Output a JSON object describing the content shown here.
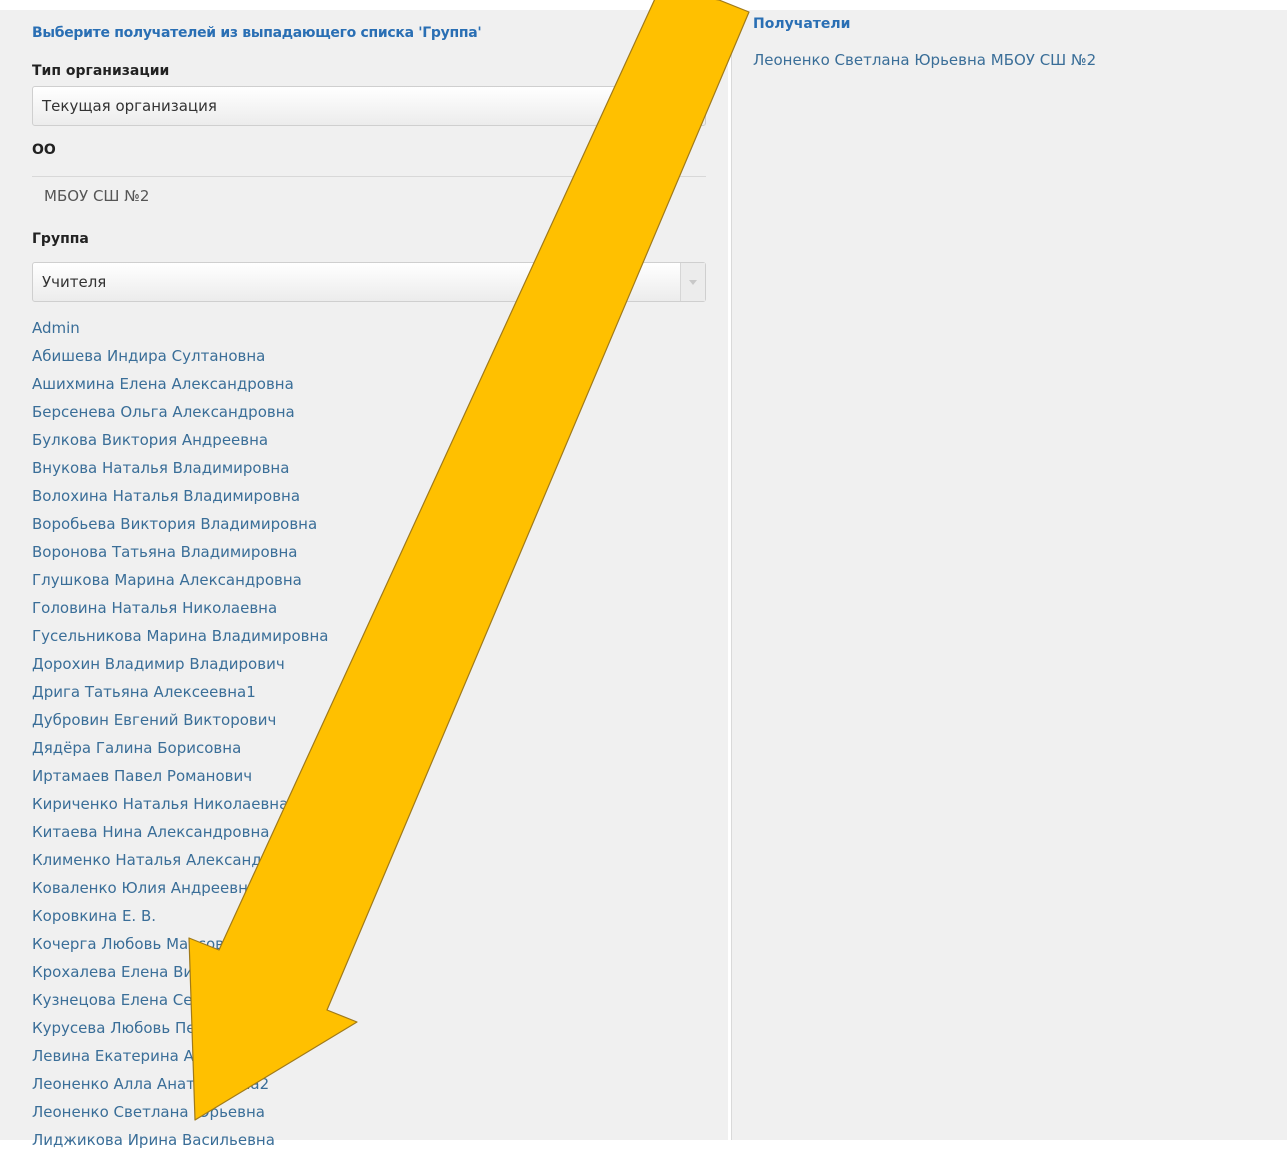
{
  "left": {
    "hint": "Выберите получателей из выпадающего списка 'Группа'",
    "org_type_label": "Тип организации",
    "org_type_value": "Текущая организация",
    "org_label": "ОО",
    "org_value": "МБОУ СШ №2",
    "group_label": "Группа",
    "group_value": "Учителя",
    "users": [
      "Admin",
      "Абишева Индира Султановна",
      "Ашихмина Елена Александровна",
      "Берсенева Ольга Александровна",
      "Булкова Виктория Андреевна",
      "Внукова Наталья Владимировна",
      "Волохина Наталья Владимировна",
      "Воробьева Виктория Владимировна",
      "Воронова Татьяна Владимировна",
      "Глушкова Марина Александровна",
      "Головина Наталья Николаевна",
      "Гусельникова Марина Владимировна",
      "Дорохин Владимир Владирович",
      "Дрига Татьяна Алексеевна1",
      "Дубровин Евгений Викторович",
      "Дядёра Галина Борисовна",
      "Иртамаев Павел Романович",
      "Кириченко Наталья Николаевна",
      "Китаева Нина Александровна",
      "Клименко Наталья Александровна",
      "Коваленко Юлия Андреевна",
      "Коровкина Е. В.",
      "Кочерга Любовь Марсовна",
      "Крохалева Елена Викторовна",
      "Кузнецова Елена Сергеевна1",
      "Курусева Любовь Петровна",
      "Левина Екатерина Андреевна1",
      "Леоненко Алла Анатольевна2",
      "Леоненко Светлана Юрьевна",
      "Лиджикова Ирина Васильевна"
    ]
  },
  "right": {
    "title": "Получатели",
    "recipients": [
      "Леоненко Светлана Юрьевна МБОУ СШ №2"
    ]
  },
  "annotation": {
    "arrow_color": "#FFC000"
  }
}
